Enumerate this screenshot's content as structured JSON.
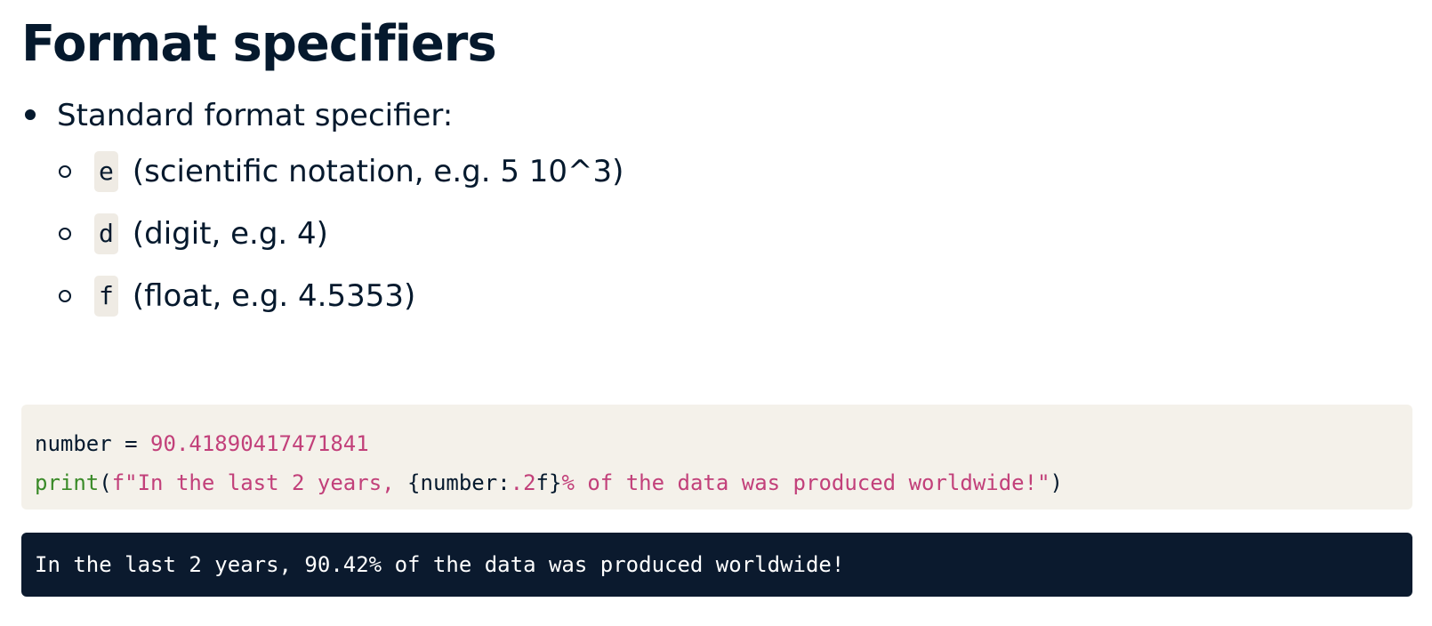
{
  "title": "Format specifiers",
  "bullet": {
    "label": "Standard format specifier:",
    "items": [
      {
        "code": "e",
        "description": "(scientific notation, e.g. 5 10^3)"
      },
      {
        "code": "d",
        "description": "(digit, e.g. 4)"
      },
      {
        "code": "f",
        "description": "(float, e.g. 4.5353)"
      }
    ]
  },
  "code": {
    "line1": {
      "var": "number = ",
      "value": "90.41890417471841"
    },
    "line2": {
      "func": "print",
      "open": "(",
      "str_start": "f\"In the last 2 years, ",
      "brace_open": "{number:",
      "spec": ".2",
      "spec_end": "f}",
      "str_end": "% of the data was produced worldwide!\"",
      "close": ")"
    }
  },
  "output": "In the last 2 years, 90.42% of the data was produced worldwide!",
  "colors": {
    "text": "#05192d",
    "code_background": "#f4f1ea",
    "output_background": "#0b1a2e",
    "code_function": "#3a8a28",
    "code_string": "#c2407a"
  }
}
